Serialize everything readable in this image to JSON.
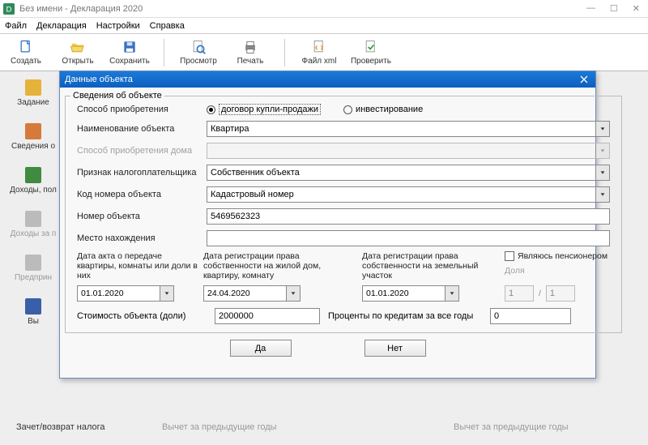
{
  "window": {
    "title": "Без имени - Декларация 2020"
  },
  "menu": {
    "file": "Файл",
    "decl": "Декларация",
    "settings": "Настройки",
    "help": "Справка"
  },
  "toolbar": {
    "create": "Создать",
    "open": "Открыть",
    "save": "Сохранить",
    "preview": "Просмотр",
    "print": "Печать",
    "filexml": "Файл xml",
    "check": "Проверить"
  },
  "leftnav": {
    "item0": "Задание",
    "item1": "Сведения о",
    "item2": "Доходы, пол",
    "item3": "Доходы за п",
    "item4": "Предприн",
    "item5": "Вы"
  },
  "bottom": {
    "refund": "Зачет/возврат налога",
    "prev_years": "Вычет за предыдущие годы",
    "prev_years2": "Вычет за предыдущие годы"
  },
  "dialog": {
    "title": "Данные объекта",
    "legend": "Сведения об объекте",
    "row_method": "Способ приобретения",
    "radio_contract": "договор купли-продажи",
    "radio_invest": "инвестирование",
    "row_name": "Наименование объекта",
    "val_name": "Квартира",
    "row_house_method": "Способ приобретения дома",
    "row_taxpayer": "Признак налогоплательщика",
    "val_taxpayer": "Собственник объекта",
    "row_code": "Код номера объекта",
    "val_code": "Кадастровый номер",
    "row_number": "Номер объекта",
    "val_number": "5469562323",
    "row_location": "Место нахождения",
    "val_location": "",
    "date_act_head": "Дата акта о передаче квартиры, комнаты или доли в них",
    "date_reg1_head": "Дата регистрации права собственности на жилой дом, квартиру, комнату",
    "date_reg2_head": "Дата регистрации права собственности на земельный участок",
    "pension_chk": "Являюсь пенсионером",
    "share_lbl": "Доля",
    "share_a": "1",
    "share_b": "1",
    "date_act": "01.01.2020",
    "date_reg1": "24.04.2020",
    "date_reg2": "01.01.2020",
    "cost_lbl": "Стоимость объекта (доли)",
    "cost_val": "2000000",
    "interest_lbl": "Проценты по кредитам за все годы",
    "interest_val": "0",
    "btn_yes": "Да",
    "btn_no": "Нет"
  }
}
